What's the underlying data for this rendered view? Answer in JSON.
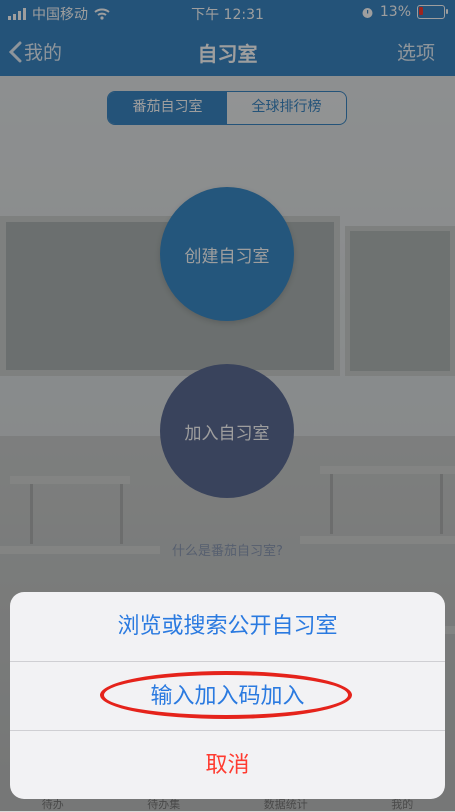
{
  "status": {
    "carrier": "中国移动",
    "time": "下午 12:31",
    "battery": "13%"
  },
  "nav": {
    "back_label": "我的",
    "title": "自习室",
    "options_label": "选项"
  },
  "segments": [
    "番茄自习室",
    "全球排行榜"
  ],
  "main": {
    "create_label": "创建自习室",
    "join_label": "加入自习室",
    "help_link": "什么是番茄自习室?"
  },
  "tabbar": [
    "待办",
    "待办集",
    "数据统计",
    "我的"
  ],
  "sheet": {
    "browse_label": "浏览或搜索公开自习室",
    "code_label": "输入加入码加入",
    "cancel_label": "取消"
  },
  "colors": {
    "accent": "#3a86c3",
    "cancel": "#ff3b30",
    "highlight_ring": "#e5231b"
  }
}
